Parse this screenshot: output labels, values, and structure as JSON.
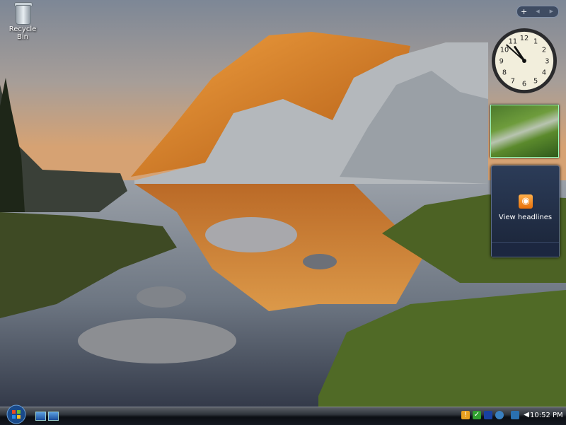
{
  "desktop": {
    "icons": [
      {
        "label": "Recycle Bin",
        "icon": "recycle-bin-icon"
      }
    ]
  },
  "sidebar": {
    "controls": {
      "add": "+",
      "prev": "◀",
      "next": "▶"
    },
    "clock": {
      "time": "10:52",
      "numerals": [
        "12",
        "1",
        "2",
        "3",
        "4",
        "5",
        "6",
        "7",
        "8",
        "9",
        "10",
        "11"
      ]
    },
    "feed": {
      "label": "View headlines",
      "icon": "rss-icon"
    }
  },
  "taskbar": {
    "start_icon": "windows-orb-icon",
    "quick_launch": [
      "show-desktop-icon",
      "switch-windows-icon"
    ],
    "tray_icons": [
      "security-shield-icon",
      "windows-defender-icon",
      "windows-sidebar-icon",
      "windows-update-icon",
      "network-icon",
      "volume-icon"
    ],
    "clock": "10:52 PM"
  },
  "colors": {
    "accent": "#ff9a2a",
    "rss": "#f08a1c"
  }
}
